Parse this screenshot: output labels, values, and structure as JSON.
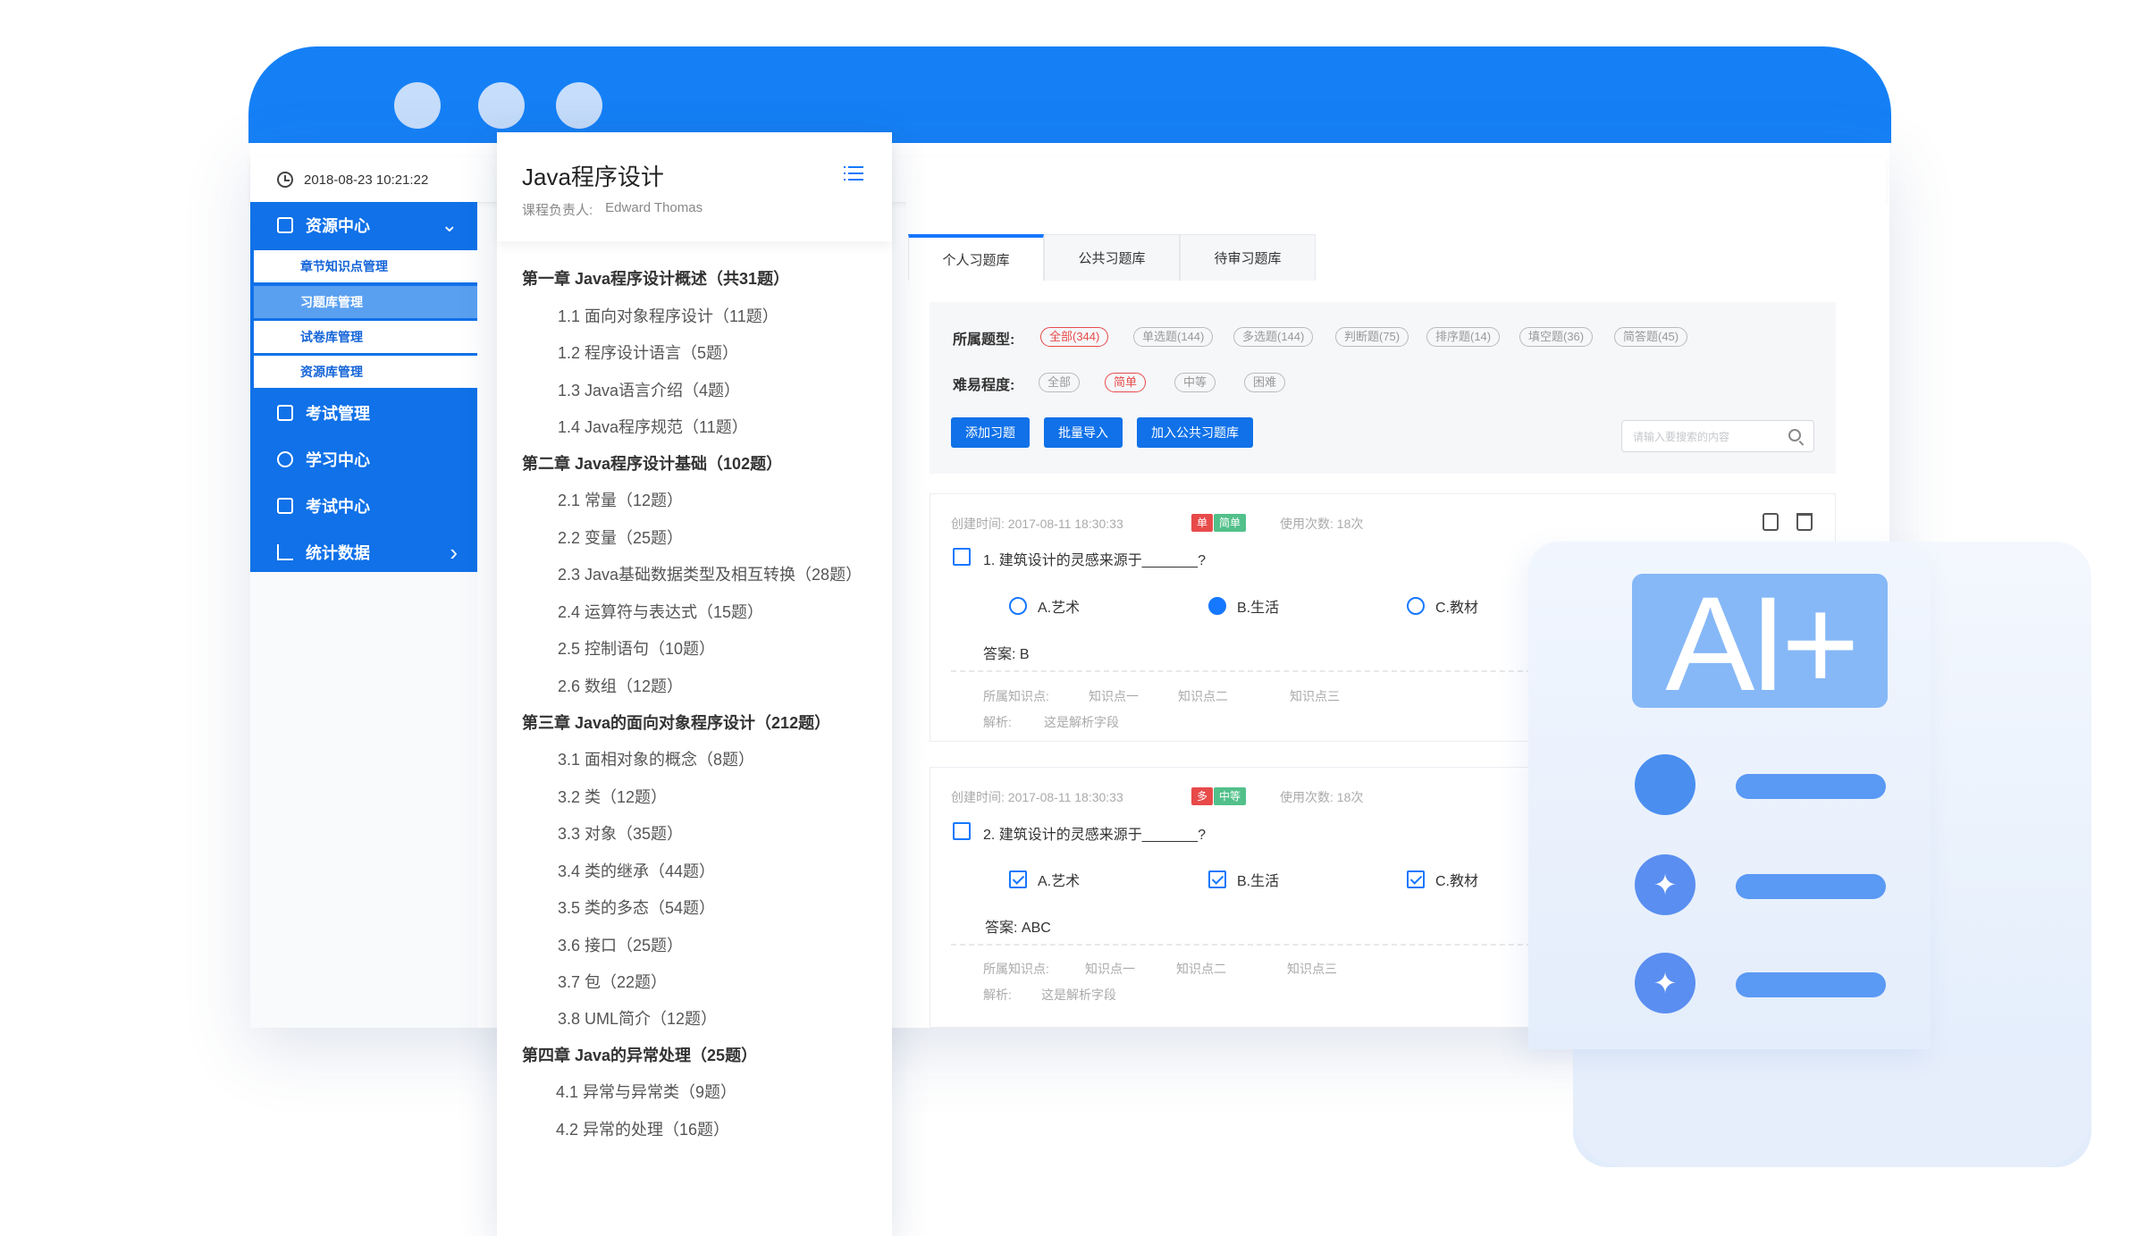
{
  "datetime": "2018-08-23 10:21:22",
  "sidebar": {
    "resource_center": "资源中心",
    "sub_items": [
      "章节知识点管理",
      "习题库管理",
      "试卷库管理",
      "资源库管理"
    ],
    "exam_manage": "考试管理",
    "study_center": "学习中心",
    "exam_center": "考试中心",
    "statistics": "统计数据"
  },
  "catalog": {
    "title": "Java程序设计",
    "owner_label": "课程负责人:",
    "owner_name": "Edward Thomas",
    "ch1": "第一章 Java程序设计概述（共31题）",
    "ch1_s": [
      "1.1 面向对象程序设计（11题）",
      "1.2 程序设计语言（5题）",
      "1.3 Java语言介绍（4题）",
      "1.4 Java程序规范（11题）"
    ],
    "ch2": "第二章 Java程序设计基础（102题）",
    "ch2_s": [
      "2.1 常量（12题）",
      "2.2 变量（25题）",
      "2.3 Java基础数据类型及相互转换（28题）",
      "2.4 运算符与表达式（15题）",
      "2.5 控制语句（10题）",
      "2.6 数组（12题）"
    ],
    "ch3": "第三章 Java的面向对象程序设计（212题）",
    "ch3_s": [
      "3.1 面相对象的概念（8题）",
      "3.2 类（12题）",
      "3.3 对象（35题）",
      "3.4 类的继承（44题）",
      "3.5 类的多态（54题）",
      "3.6 接口（25题）",
      "3.7 包（22题）",
      "3.8 UML简介（12题）"
    ],
    "ch4": "第四章 Java的异常处理（25题）",
    "ch4_s": [
      "4.1 异常与异常类（9题）",
      "4.2 异常的处理（16题）"
    ]
  },
  "tabs": [
    "个人习题库",
    "公共习题库",
    "待审习题库"
  ],
  "filters": {
    "type_label": "所属题型:",
    "types": [
      "全部(344)",
      "单选题(144)",
      "多选题(144)",
      "判断题(75)",
      "排序题(14)",
      "填空题(36)",
      "简答题(45)"
    ],
    "difficulty_label": "难易程度:",
    "difficulties": [
      "全部",
      "简单",
      "中等",
      "困难"
    ]
  },
  "actions": {
    "add": "添加习题",
    "import": "批量导入",
    "to_public": "加入公共习题库"
  },
  "search": {
    "placeholder": "请输入要搜索的内容"
  },
  "questions": [
    {
      "created": "创建时间: 2017-08-11 18:30:33",
      "type_badge": "单",
      "level_badge": "简单",
      "usage": "使用次数: 18次",
      "text": "1. 建筑设计的灵感来源于_______?",
      "options": [
        "A.艺术",
        "B.生活",
        "C.教材"
      ],
      "answer": "答案: B",
      "kp_label": "所属知识点:",
      "kps": [
        "知识点一",
        "知识点二",
        "知识点三"
      ],
      "analysis_label": "解析:",
      "analysis": "这是解析字段"
    },
    {
      "created": "创建时间: 2017-08-11 18:30:33",
      "type_badge": "多",
      "level_badge": "中等",
      "usage": "使用次数: 18次",
      "text": "2. 建筑设计的灵感来源于_______?",
      "options": [
        "A.艺术",
        "B.生活",
        "C.教材"
      ],
      "answer": "答案: ABC",
      "kp_label": "所属知识点:",
      "kps": [
        "知识点一",
        "知识点二",
        "知识点三"
      ],
      "analysis_label": "解析:",
      "analysis": "这是解析字段"
    }
  ],
  "ai": {
    "logo": "AI+",
    "sparkle": "✦"
  },
  "colors": {
    "brand": "#1580f6",
    "sidebar": "#1071e8",
    "accent_red": "#e84a4a",
    "badge_green": "#52c08a",
    "ai_blue": "#86b8f7"
  }
}
